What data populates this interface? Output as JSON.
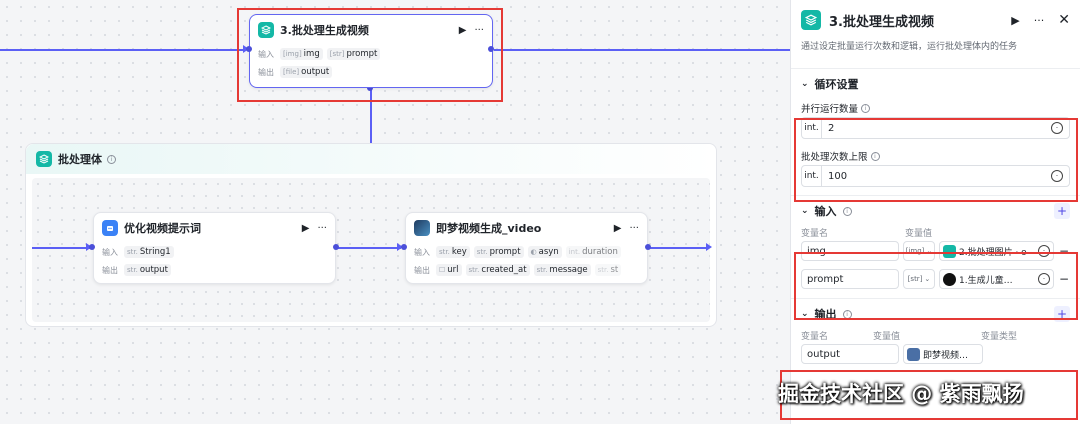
{
  "main_node": {
    "title": "3.批处理生成视频",
    "input_label": "输入",
    "output_label": "输出",
    "inputs": [
      {
        "type": "[img]",
        "name": "img"
      },
      {
        "type": "[str]",
        "name": "prompt"
      }
    ],
    "outputs": [
      {
        "type": "[file]",
        "name": "output"
      }
    ]
  },
  "batch": {
    "title": "批处理体",
    "node_optimize": {
      "title": "优化视频提示词",
      "input_label": "输入",
      "output_label": "输出",
      "inputs": [
        {
          "type": "str.",
          "name": "String1"
        }
      ],
      "outputs": [
        {
          "type": "str.",
          "name": "output"
        }
      ]
    },
    "node_video": {
      "title": "即梦视频生成_video",
      "input_label": "输入",
      "output_label": "输出",
      "inputs": [
        {
          "type": "str.",
          "name": "key"
        },
        {
          "type": "str.",
          "name": "prompt"
        },
        {
          "type": "◐",
          "name": "asyn"
        },
        {
          "type": "int.",
          "name": "duration"
        }
      ],
      "outputs": [
        {
          "type": "☐",
          "name": "url"
        },
        {
          "type": "str.",
          "name": "created_at"
        },
        {
          "type": "str.",
          "name": "message"
        },
        {
          "type": "str.",
          "name": "st"
        }
      ]
    }
  },
  "panel": {
    "title": "3.批处理生成视频",
    "description": "通过设定批量运行次数和逻辑，运行批处理体内的任务",
    "loop": {
      "title": "循环设置",
      "parallel_label": "并行运行数量",
      "parallel_type": "int.",
      "parallel_value": "2",
      "max_label": "批处理次数上限",
      "max_type": "int.",
      "max_value": "100"
    },
    "inputs": {
      "title": "输入",
      "col_name": "变量名",
      "col_value": "变量值",
      "rows": [
        {
          "name": "img",
          "type": "[img]",
          "ref": "2.批处理图片 · o"
        },
        {
          "name": "prompt",
          "type": "[str]",
          "ref": "1.生成儿童…"
        }
      ]
    },
    "outputs": {
      "title": "输出",
      "col_name": "变量名",
      "col_value": "变量值",
      "col_type": "变量类型",
      "rows": [
        {
          "name": "output",
          "ref": "即梦视频…"
        }
      ]
    }
  },
  "watermark": "掘金技术社区 @ 紫雨飘扬",
  "colors": {
    "accent": "#5b5ff5",
    "teal": "#14b8a6",
    "highlight": "#e53935"
  }
}
